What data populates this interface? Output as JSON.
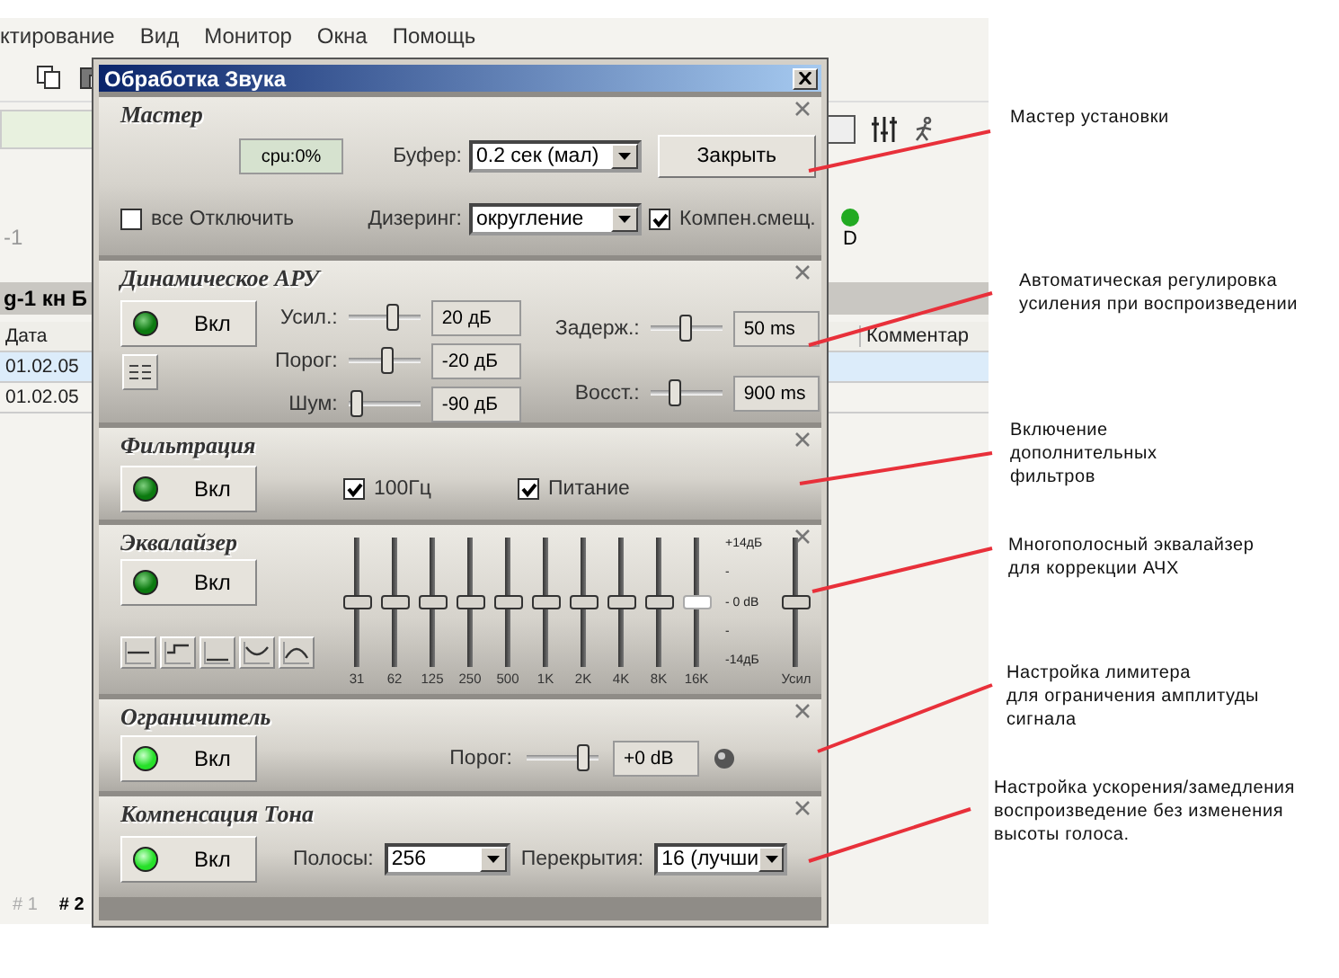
{
  "background_app": {
    "menu": [
      "ктирование",
      "Вид",
      "Монитор",
      "Окна",
      "Помощь"
    ],
    "row_label": "-1",
    "indicator": {
      "label": "D"
    },
    "group_header": "g-1  кн Б",
    "table": {
      "columns": [
        "Дата",
        "Комментар"
      ],
      "rows": [
        {
          "cells": [
            "01.02.05"
          ],
          "selected": true
        },
        {
          "cells": [
            "01.02.05"
          ],
          "selected": false
        }
      ]
    },
    "tabs": [
      {
        "label": "# 1",
        "selected": false
      },
      {
        "label": "# 2",
        "selected": true
      }
    ]
  },
  "window": {
    "title": "Обработка Звука"
  },
  "sections": [
    {
      "kind": "master",
      "title": "Мастер",
      "cpu": "cpu:0%",
      "buffer": {
        "label": "Буфер:",
        "value": "0.2 сек (мал)"
      },
      "close_button": "Закрыть",
      "disable_all": {
        "label": "все Отключить",
        "checked": false
      },
      "dither": {
        "label": "Дизеринг:",
        "value": "округление"
      },
      "dc_offset": {
        "label": "Компен.смещ.",
        "checked": true
      }
    },
    {
      "kind": "agc",
      "title": "Динамическое АРУ",
      "toggle": {
        "label": "Вкл",
        "on": false
      },
      "sliders": [
        {
          "label": "Усил.:",
          "level": 0.65,
          "reading": "20 дБ"
        },
        {
          "label": "Порог:",
          "level": 0.55,
          "reading": "-20 дБ"
        },
        {
          "label": "Шум:",
          "level": 0.05,
          "reading": "-90 дБ"
        },
        {
          "label": "Задерж.:",
          "level": 0.5,
          "reading": "50 ms"
        },
        {
          "label": "Восст.:",
          "level": 0.3,
          "reading": "900 ms"
        }
      ]
    },
    {
      "kind": "filter",
      "title": "Фильтрация",
      "toggle": {
        "label": "Вкл",
        "on": false
      },
      "checkboxes": [
        {
          "label": "100Гц",
          "checked": true
        },
        {
          "label": "Питание",
          "checked": true
        }
      ]
    },
    {
      "kind": "equalizer",
      "title": "Эквалайзер",
      "toggle": {
        "label": "Вкл",
        "on": false
      },
      "bands": [
        {
          "label": "31",
          "level": 0.5,
          "selected": false
        },
        {
          "label": "62",
          "level": 0.5,
          "selected": false
        },
        {
          "label": "125",
          "level": 0.5,
          "selected": false
        },
        {
          "label": "250",
          "level": 0.5,
          "selected": false
        },
        {
          "label": "500",
          "level": 0.5,
          "selected": false
        },
        {
          "label": "1K",
          "level": 0.5,
          "selected": false
        },
        {
          "label": "2K",
          "level": 0.5,
          "selected": false
        },
        {
          "label": "4K",
          "level": 0.5,
          "selected": false
        },
        {
          "label": "8K",
          "level": 0.5,
          "selected": false
        },
        {
          "label": "16K",
          "level": 0.5,
          "selected": true
        }
      ],
      "scale": [
        "+14дБ",
        "-",
        "- 0 dB",
        "-",
        "-14дБ"
      ],
      "gain": {
        "label": "Усил",
        "level": 0.5
      }
    },
    {
      "kind": "limiter",
      "title": "Ограничитель",
      "toggle": {
        "label": "Вкл",
        "on": true
      },
      "slider": {
        "label": "Порог:",
        "level": 0.85,
        "reading": "+0 dB"
      }
    },
    {
      "kind": "tone",
      "title": "Компенсация Тона",
      "toggle": {
        "label": "Вкл",
        "on": true
      },
      "dropdowns": [
        {
          "label": "Полосы:",
          "value": "256"
        },
        {
          "label": "Перекрытия:",
          "value": "16 (лучши"
        }
      ]
    }
  ],
  "annotations": [
    {
      "text": "Мастер установки"
    },
    {
      "text": "Автоматическая регулировка\nусиления при воспроизведении"
    },
    {
      "text": "Включение\nдополнительных\nфильтров"
    },
    {
      "text": "Многополосный эквалайзер\nдля коррекции АЧХ"
    },
    {
      "text": "Настройка лимитера\nдля ограничения амплитуды\nсигнала"
    },
    {
      "text": "Настройка ускорения/замедления\nвоспроизведение без изменения\nвысоты голоса."
    }
  ]
}
